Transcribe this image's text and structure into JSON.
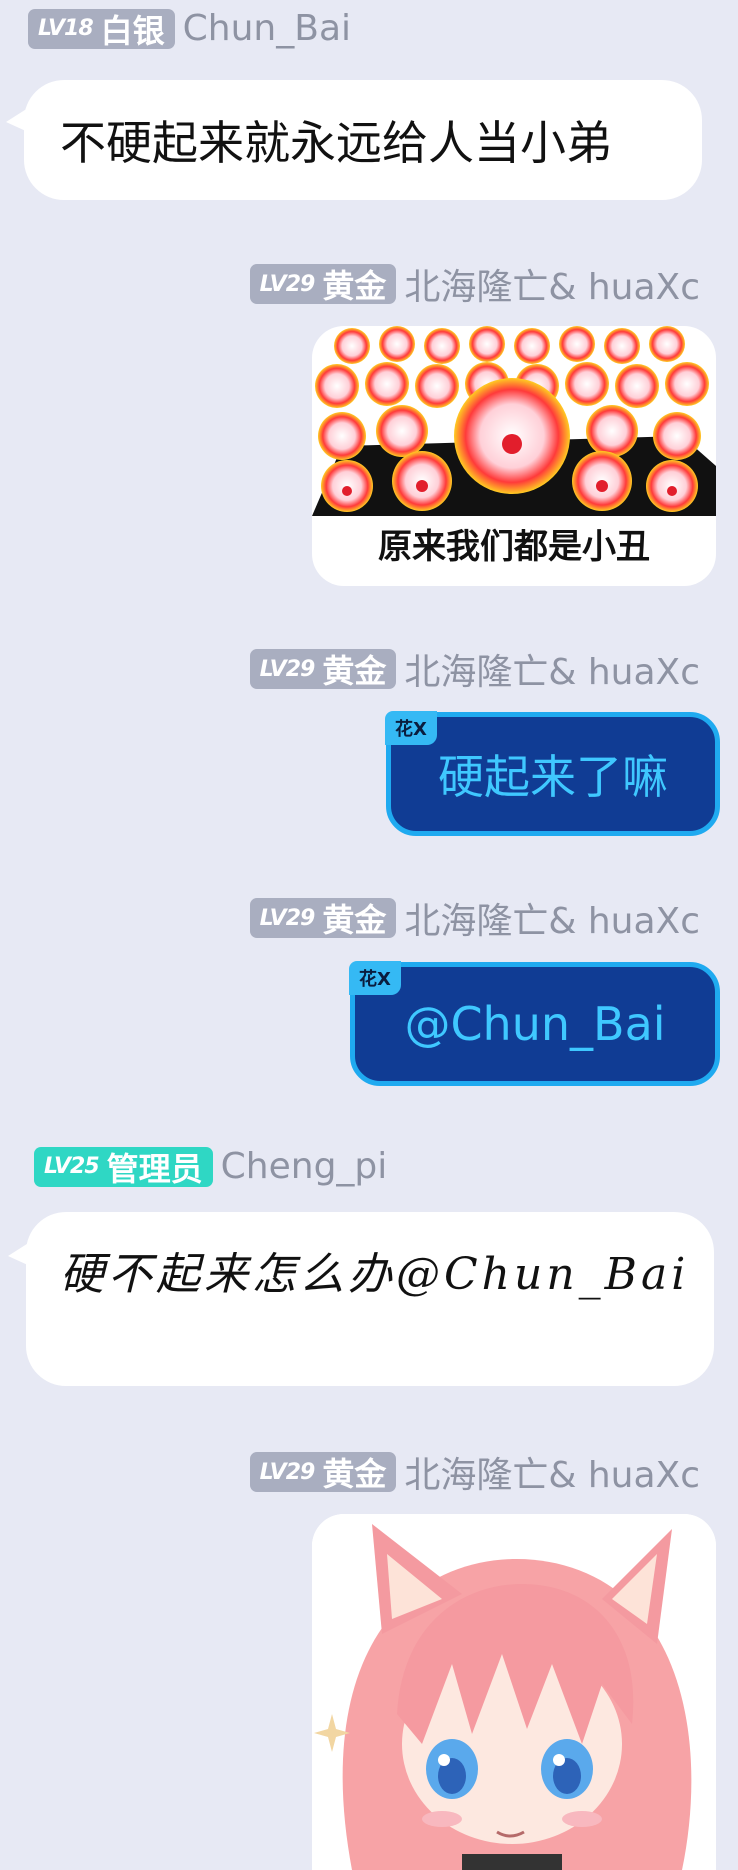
{
  "messages": [
    {
      "level": "LV18",
      "rank": "白银",
      "user": "Chun_Bai",
      "text": "不硬起来就永远给人当小弟"
    },
    {
      "level": "LV29",
      "rank": "黄金",
      "user": "北海隆亡& huaXc",
      "caption": "原来我们都是小丑"
    },
    {
      "level": "LV29",
      "rank": "黄金",
      "user": "北海隆亡& huaXc",
      "tag": "花X",
      "text": "硬起来了嘛"
    },
    {
      "level": "LV29",
      "rank": "黄金",
      "user": "北海隆亡& huaXc",
      "tag": "花X",
      "text": "@Chun_Bai"
    },
    {
      "level": "LV25",
      "rank": "管理员",
      "user": "Cheng_pi",
      "text": "硬不起来怎么办@Chun_Bai"
    },
    {
      "level": "LV29",
      "rank": "黄金",
      "user": "北海隆亡& huaXc"
    }
  ],
  "colors": {
    "background": "#e7e9f4",
    "badge_gray": "#a9aec0",
    "badge_admin": "#2fd7c4",
    "blue_bubble": "#103c94",
    "blue_border": "#1faaf0",
    "blue_text": "#3fc8ff"
  }
}
